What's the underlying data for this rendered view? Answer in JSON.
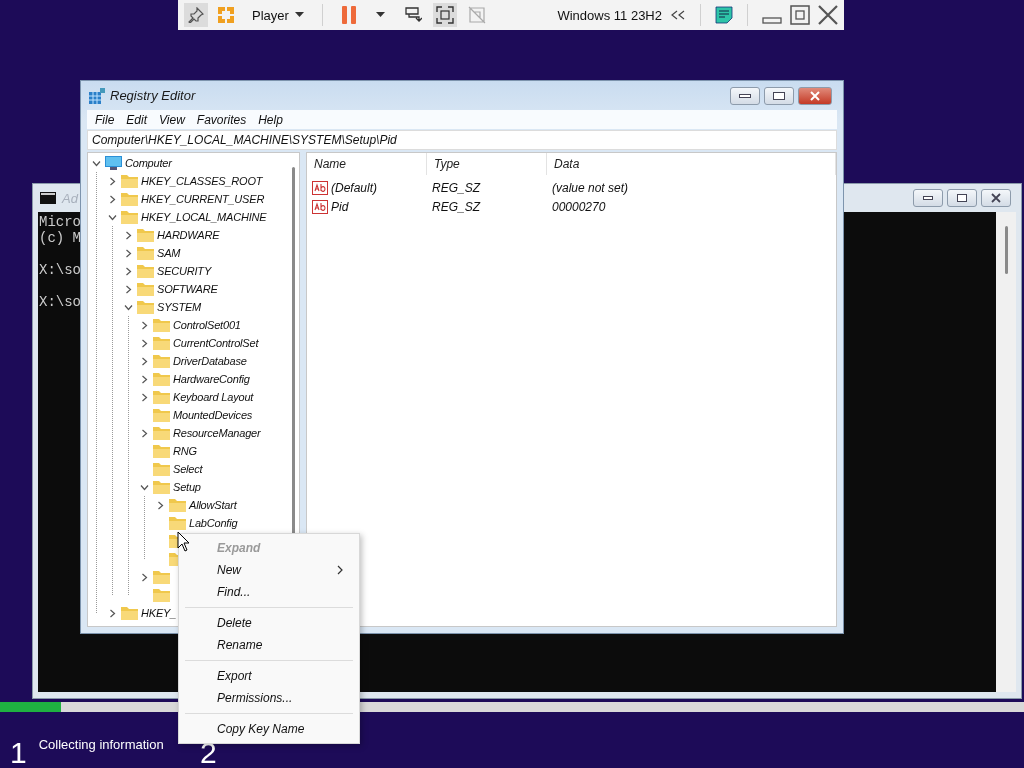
{
  "vm_toolbar": {
    "left": [
      {
        "kind": "pin",
        "pressed": true
      },
      {
        "kind": "logo"
      },
      {
        "kind": "menu",
        "label": "Player"
      },
      {
        "kind": "separator"
      },
      {
        "kind": "pause",
        "pressed": false
      },
      {
        "kind": "caret"
      },
      {
        "kind": "send-keys",
        "pressed": false
      },
      {
        "kind": "fullscreen",
        "pressed": true
      },
      {
        "kind": "unity",
        "pressed": false
      }
    ],
    "right": [
      {
        "kind": "title",
        "label": "Windows 11 23H2"
      },
      {
        "kind": "collapse"
      },
      {
        "kind": "separator"
      },
      {
        "kind": "note"
      },
      {
        "kind": "separator"
      },
      {
        "kind": "minimize"
      },
      {
        "kind": "restore"
      },
      {
        "kind": "close"
      }
    ]
  },
  "console": {
    "title": "Ad",
    "blocks": [
      [
        "Micro",
        "(c) M"
      ],
      [
        "X:\\so"
      ],
      [
        "X:\\so"
      ]
    ]
  },
  "registry": {
    "title": "Registry Editor",
    "menu": [
      "File",
      "Edit",
      "View",
      "Favorites",
      "Help"
    ],
    "address": "Computer\\HKEY_LOCAL_MACHINE\\SYSTEM\\Setup\\Pid",
    "tree": [
      {
        "label": "Computer",
        "kind": "computer",
        "expanded": true,
        "children": [
          {
            "label": "HKEY_CLASSES_ROOT",
            "kind": "folder",
            "expanded": false
          },
          {
            "label": "HKEY_CURRENT_USER",
            "kind": "folder",
            "expanded": false
          },
          {
            "label": "HKEY_LOCAL_MACHINE",
            "kind": "folder",
            "expanded": true,
            "children": [
              {
                "label": "HARDWARE",
                "kind": "folder",
                "expanded": false
              },
              {
                "label": "SAM",
                "kind": "folder",
                "expanded": false
              },
              {
                "label": "SECURITY",
                "kind": "folder",
                "expanded": false
              },
              {
                "label": "SOFTWARE",
                "kind": "folder",
                "expanded": false
              },
              {
                "label": "SYSTEM",
                "kind": "folder",
                "expanded": true,
                "children": [
                  {
                    "label": "ControlSet001",
                    "kind": "folder",
                    "expanded": false
                  },
                  {
                    "label": "CurrentControlSet",
                    "kind": "folder",
                    "expanded": false
                  },
                  {
                    "label": "DriverDatabase",
                    "kind": "folder",
                    "expanded": false
                  },
                  {
                    "label": "HardwareConfig",
                    "kind": "folder",
                    "expanded": false
                  },
                  {
                    "label": "Keyboard Layout",
                    "kind": "folder",
                    "expanded": false
                  },
                  {
                    "label": "MountedDevices",
                    "kind": "folder"
                  },
                  {
                    "label": "ResourceManager",
                    "kind": "folder",
                    "expanded": false
                  },
                  {
                    "label": "RNG",
                    "kind": "folder"
                  },
                  {
                    "label": "Select",
                    "kind": "folder"
                  },
                  {
                    "label": "Setup",
                    "kind": "folder",
                    "expanded": true,
                    "children": [
                      {
                        "label": "AllowStart",
                        "kind": "folder",
                        "expanded": false
                      },
                      {
                        "label": "LabConfig",
                        "kind": "folder"
                      },
                      {
                        "kind": "folder"
                      },
                      {
                        "kind": "folder"
                      }
                    ]
                  },
                  {
                    "kind": "folder",
                    "expanded": false
                  },
                  {
                    "kind": "folder"
                  }
                ]
              }
            ]
          },
          {
            "label": "HKEY_",
            "kind": "folder",
            "expanded": false
          }
        ]
      }
    ],
    "columns": [
      "Name",
      "Type",
      "Data"
    ],
    "values": [
      {
        "name": "(Default)",
        "type": "REG_SZ",
        "data": "(value not set)"
      },
      {
        "name": "Pid",
        "type": "REG_SZ",
        "data": "00000270"
      }
    ]
  },
  "context_menu": [
    {
      "kind": "item",
      "label": "Expand",
      "disabled": true,
      "submenu": false
    },
    {
      "kind": "item",
      "label": "New",
      "disabled": false,
      "submenu": true
    },
    {
      "kind": "item",
      "label": "Find...",
      "disabled": false,
      "submenu": false
    },
    {
      "kind": "separator"
    },
    {
      "kind": "item",
      "label": "Delete",
      "disabled": false,
      "submenu": false
    },
    {
      "kind": "item",
      "label": "Rename",
      "disabled": false,
      "submenu": false
    },
    {
      "kind": "separator"
    },
    {
      "kind": "item",
      "label": "Export",
      "disabled": false,
      "submenu": false
    },
    {
      "kind": "item",
      "label": "Permissions...",
      "disabled": false,
      "submenu": false
    },
    {
      "kind": "separator"
    },
    {
      "kind": "item",
      "label": "Copy Key Name",
      "disabled": false,
      "submenu": false
    }
  ],
  "setup_progress": {
    "level": 0.06,
    "steps": [
      {
        "number": "1",
        "label": "Collecting information"
      },
      {
        "number": "2"
      }
    ]
  }
}
